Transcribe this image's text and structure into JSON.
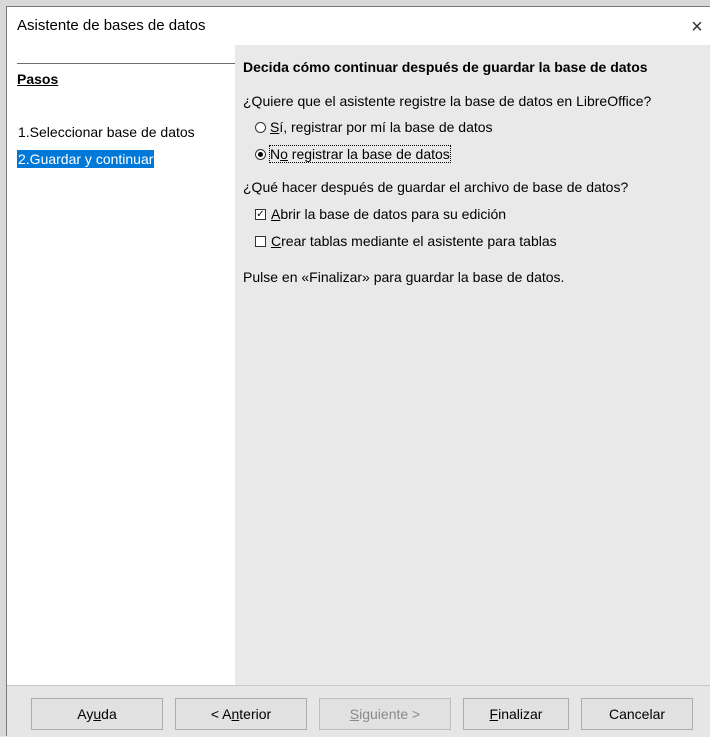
{
  "window": {
    "title": "Asistente de bases de datos",
    "close_glyph": "×"
  },
  "sidebar": {
    "title": "Pasos",
    "items": [
      {
        "label": "1.Seleccionar base de datos",
        "selected": false
      },
      {
        "label": "2.Guardar y continuar",
        "selected": true
      }
    ]
  },
  "main": {
    "heading": "Decida cómo continuar después de guardar la base de datos",
    "register_question": "¿Quiere que el asistente registre la base de datos en LibreOffice?",
    "register_options": [
      {
        "label": "Sí, registrar por mí la base de datos",
        "mnemonic": "S",
        "selected": false
      },
      {
        "label": "No registrar la base de datos",
        "mnemonic": "o",
        "selected": true
      }
    ],
    "after_question": "¿Qué hacer después de guardar el archivo de base de datos?",
    "after_options": [
      {
        "label": "Abrir la base de datos para su edición",
        "mnemonic": "A",
        "checked": true
      },
      {
        "label": "Crear tablas mediante el asistente para tablas",
        "mnemonic": "C",
        "checked": false
      }
    ],
    "note": "Pulse en «Finalizar» para guardar la base de datos."
  },
  "buttons": {
    "help": "Ayuda",
    "back": "< Anterior",
    "next": "Siguiente >",
    "finish": "Finalizar",
    "cancel": "Cancelar"
  },
  "colors": {
    "selection": "#0078d7",
    "right_pane_bg": "#e9e9e9"
  }
}
